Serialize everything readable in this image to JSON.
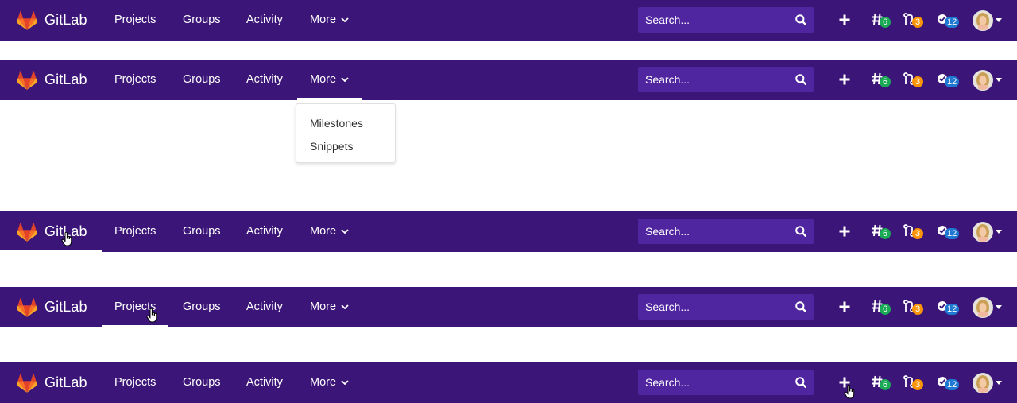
{
  "brand": {
    "name": "GitLab",
    "logo_icon": "gitlab-tanuki-icon",
    "colors": [
      "#e24329",
      "#fc6d26",
      "#fca326"
    ]
  },
  "navbar_color": "#3b1577",
  "nav": {
    "projects": "Projects",
    "groups": "Groups",
    "activity": "Activity",
    "more": "More"
  },
  "search": {
    "placeholder": "Search...",
    "icon": "search-icon"
  },
  "counters": {
    "issues": "6",
    "merge_requests": "3",
    "todos": "12"
  },
  "more_dropdown": {
    "items": [
      "Milestones",
      "Snippets"
    ]
  },
  "states": [
    {
      "state": "default"
    },
    {
      "state": "more-dropdown-open",
      "active_item": "More"
    },
    {
      "state": "hover-logo",
      "active_item": "GitLab"
    },
    {
      "state": "hover-projects",
      "active_item": "Projects"
    },
    {
      "state": "hover-new-button",
      "active_item": "new-item-plus"
    }
  ]
}
